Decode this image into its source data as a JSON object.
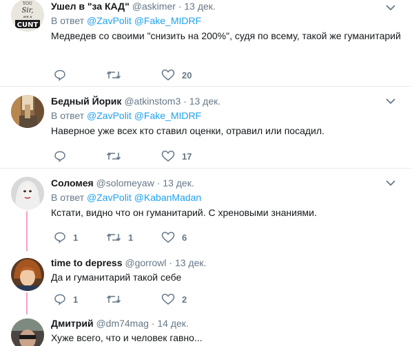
{
  "tweets": [
    {
      "name": "Ушел в \"за КАД\"",
      "handle": "@askimer",
      "date": "13 дек.",
      "reply_prefix": "В ответ",
      "mentions": [
        "@ZavPolit",
        "@Fake_MIDRF"
      ],
      "text": "Медведев со своими \"снизить на 200%\", судя по всему, такой же гуманитарий",
      "replies": "",
      "retweets": "",
      "likes": "20",
      "avatar_text": [
        "YOU",
        "Sir,",
        "are a",
        "CUNT"
      ]
    },
    {
      "name": "Бедный Йорик",
      "handle": "@atkinstom3",
      "date": "13 дек.",
      "reply_prefix": "В ответ",
      "mentions": [
        "@ZavPolit",
        "@Fake_MIDRF"
      ],
      "text": "Наверное уже всех кто ставил оценки, отравил или посадил.",
      "replies": "",
      "retweets": "",
      "likes": "17"
    },
    {
      "name": "Соломея",
      "handle": "@solomeyaw",
      "date": "13 дек.",
      "reply_prefix": "В ответ",
      "mentions": [
        "@ZavPolit",
        "@KabanMadan"
      ],
      "text": "Кстати, видно что он гуманитарий. С хреновыми знаниями.",
      "replies": "1",
      "retweets": "1",
      "likes": "6"
    },
    {
      "name": "time to depress",
      "handle": "@gorrowl",
      "date": "13 дек.",
      "text": "Да и гуманитарий такой себе",
      "replies": "1",
      "retweets": "",
      "likes": "2"
    },
    {
      "name": "Дмитрий",
      "handle": "@dm74mag",
      "date": "14 дек.",
      "text": "Хуже всего, что и человек гавно..."
    }
  ],
  "colors": {
    "link": "#1da1f2",
    "muted": "#657786",
    "thread": "#f7a1c7",
    "divider": "#e6ecf0"
  }
}
